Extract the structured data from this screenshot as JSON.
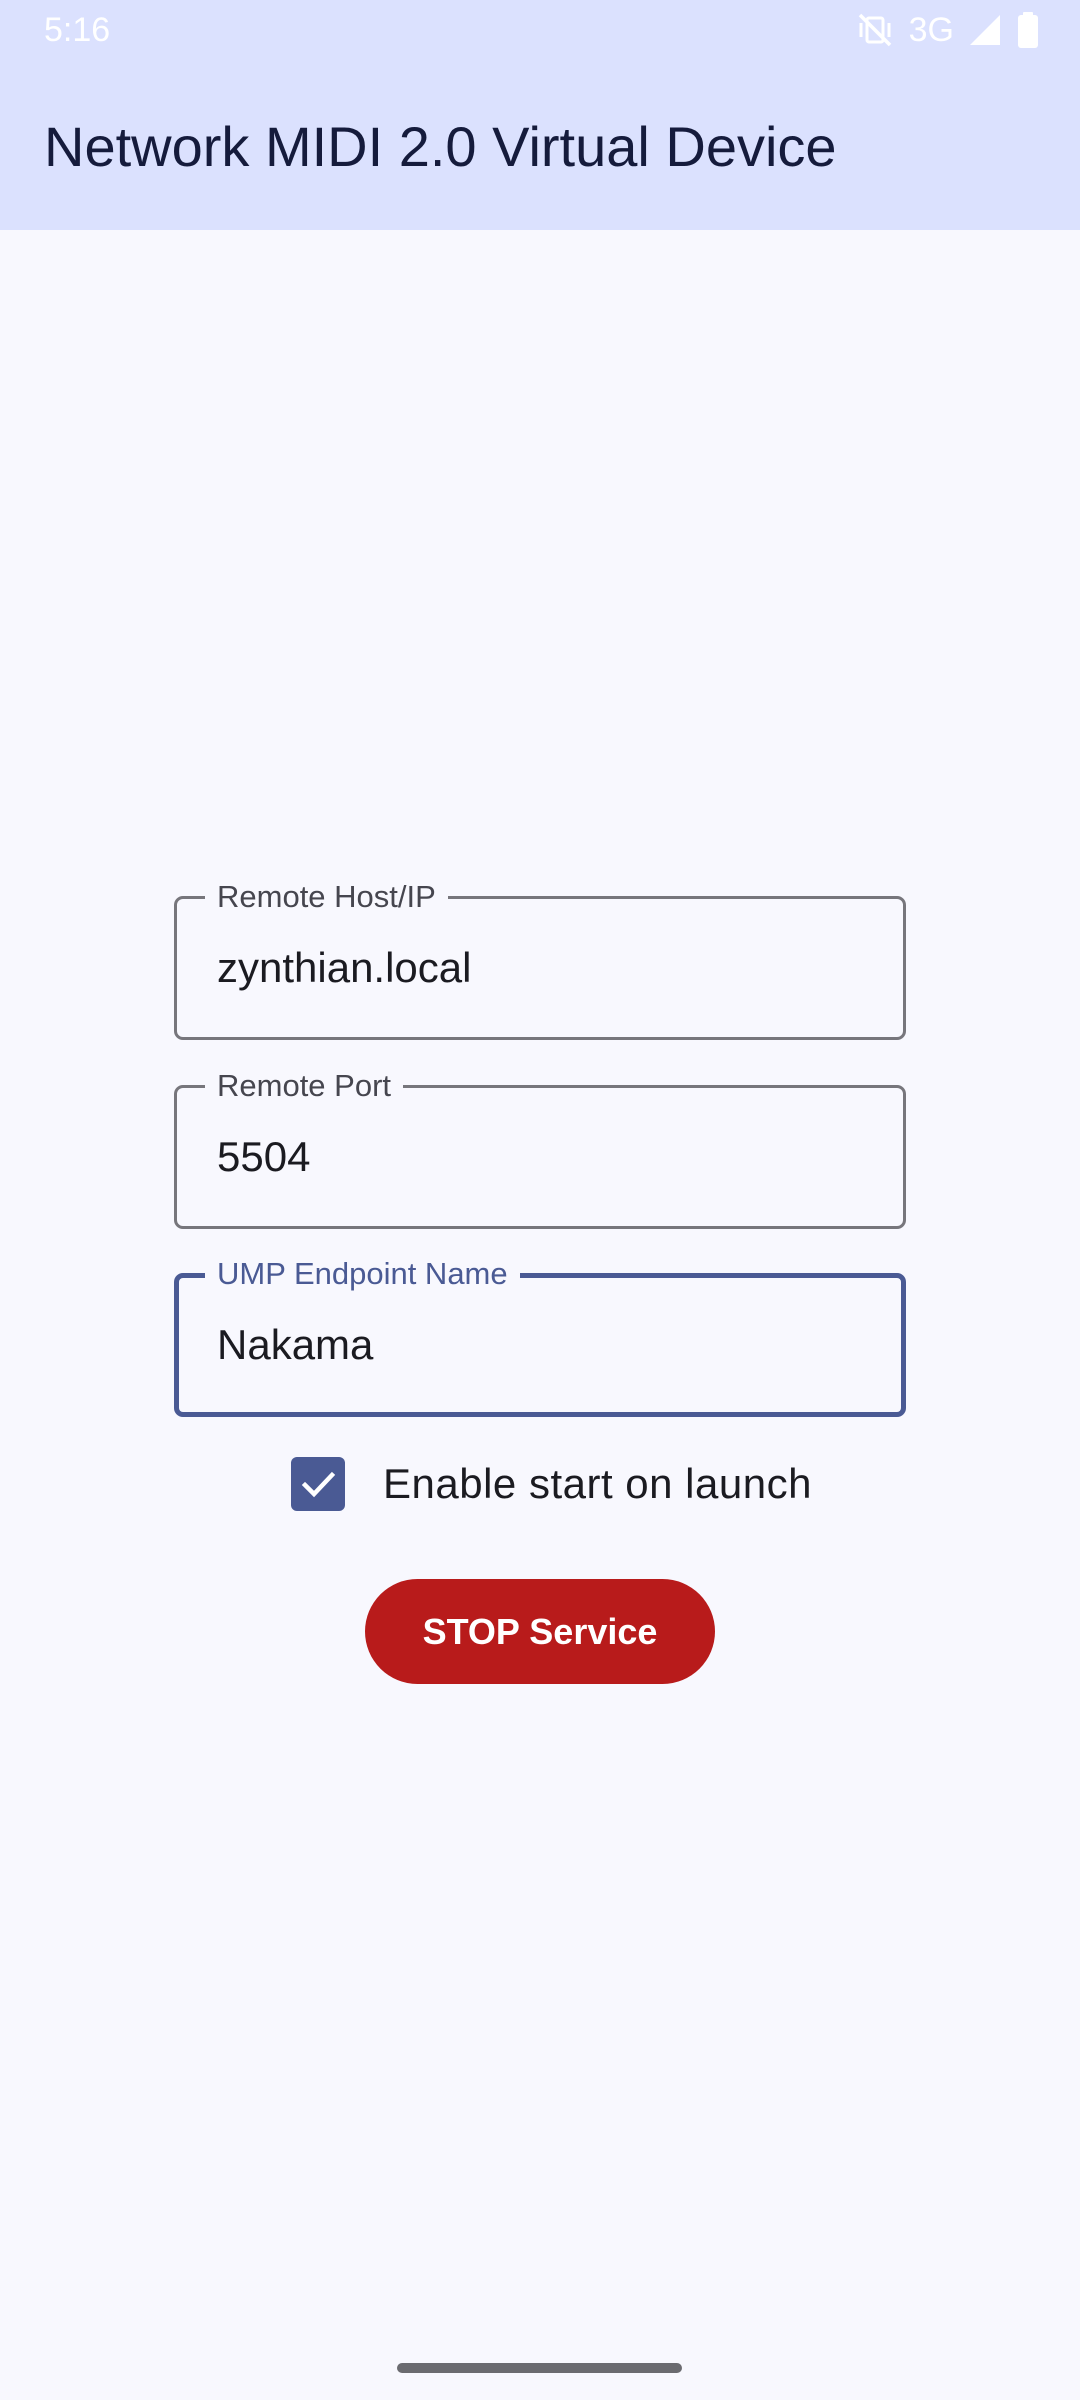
{
  "status_bar": {
    "time": "5:16",
    "network": "3G",
    "icons": [
      "vibrate-off-icon",
      "signal-icon",
      "battery-icon"
    ]
  },
  "app_bar": {
    "title": "Network MIDI 2.0 Virtual Device"
  },
  "form": {
    "remote_host": {
      "label": "Remote Host/IP",
      "value": "zynthian.local"
    },
    "remote_port": {
      "label": "Remote Port",
      "value": "5504"
    },
    "ump_endpoint_name": {
      "label": "UMP Endpoint Name",
      "value": "Nakama",
      "focused": true
    },
    "enable_start_on_launch": {
      "label": "Enable start on launch",
      "checked": true
    },
    "service_button": {
      "label": "STOP Service"
    }
  },
  "colors": {
    "app_bar_bg": "#dbe1fe",
    "page_bg": "#f8f8fe",
    "accent": "#4a5a94",
    "stop_button": "#b81b1b"
  }
}
